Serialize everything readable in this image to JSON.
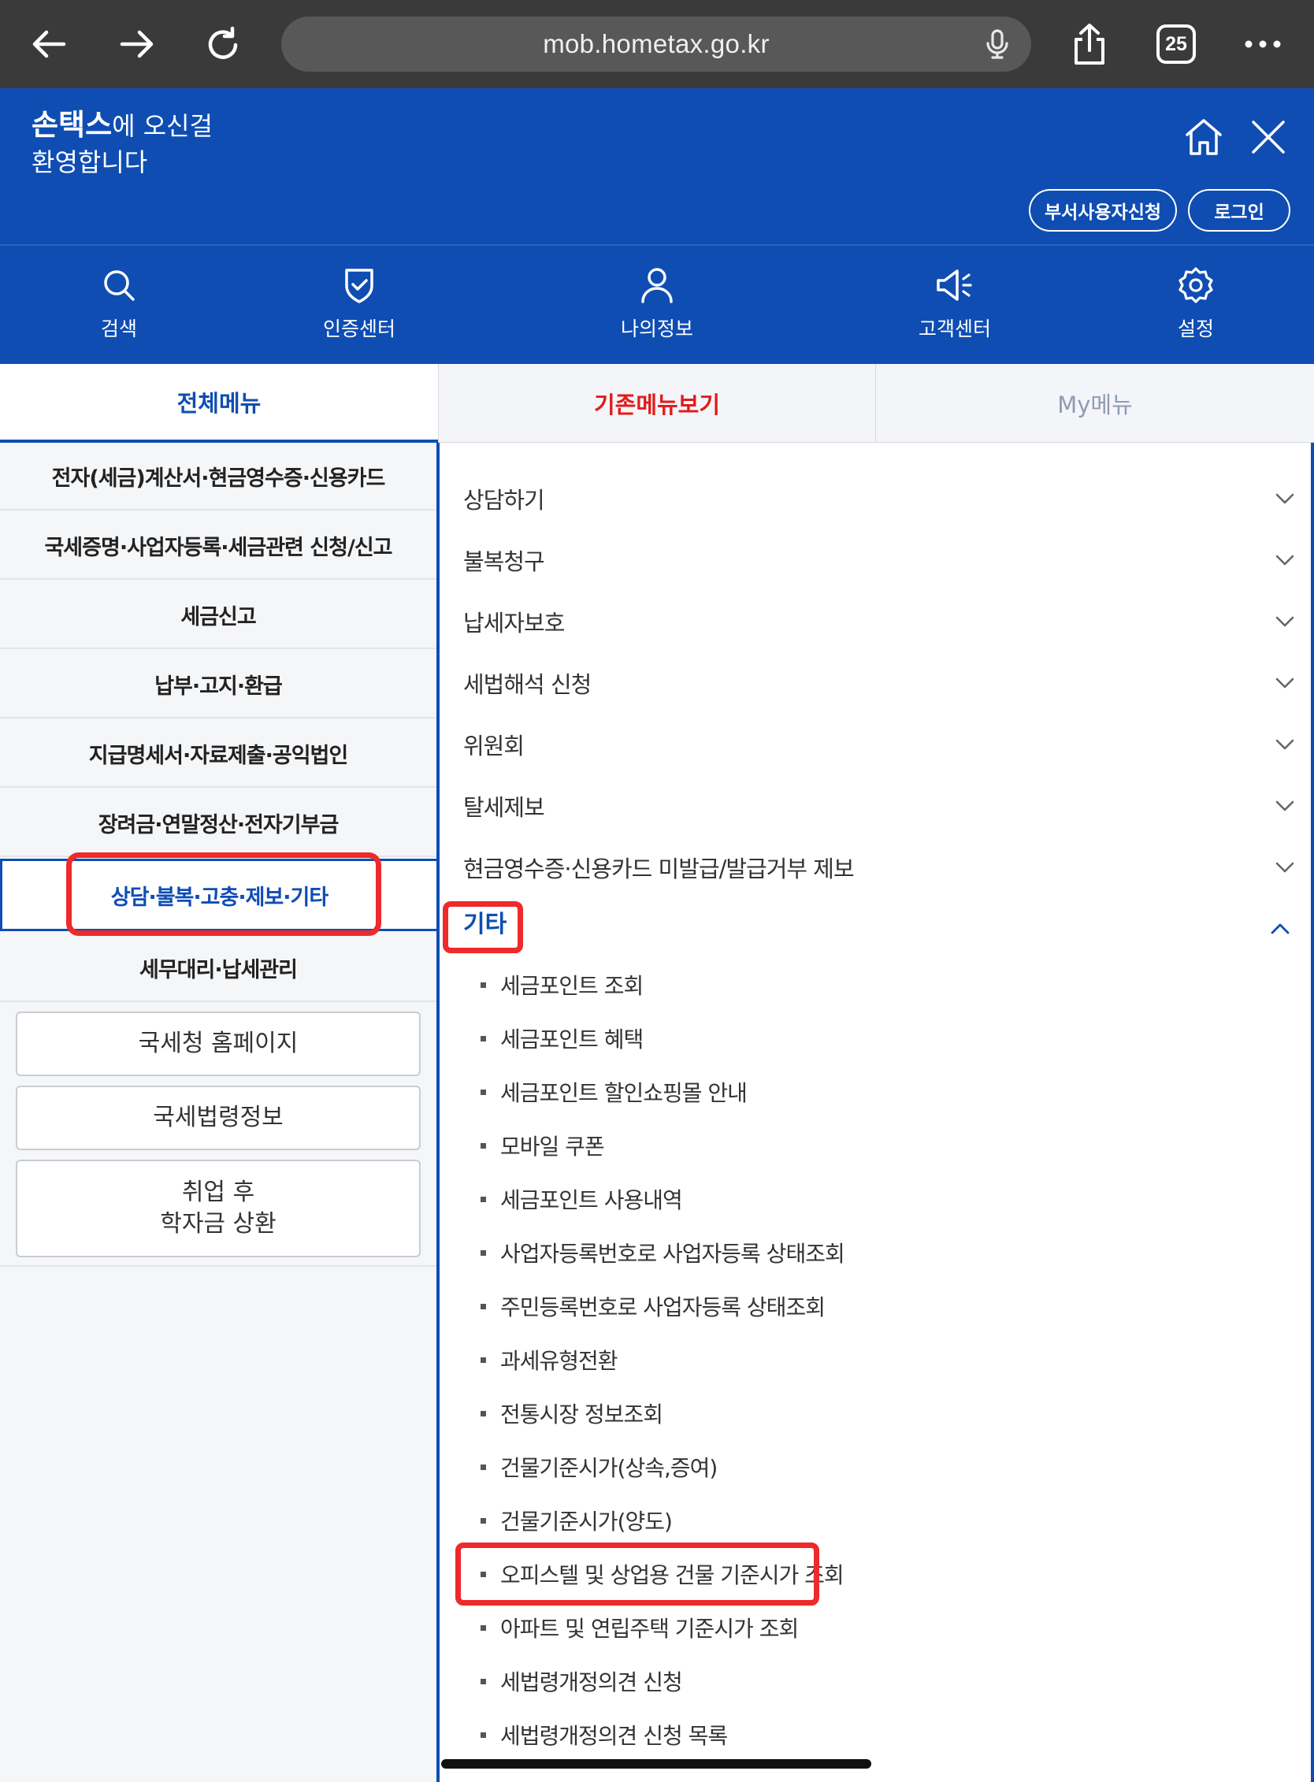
{
  "browser": {
    "url": "mob.hometax.go.kr",
    "tab_count": "25",
    "icons": [
      "back-arrow-icon",
      "forward-arrow-icon",
      "reload-icon",
      "microphone-icon",
      "share-icon",
      "tabs-icon",
      "more-icon"
    ]
  },
  "header": {
    "brand": "손택스",
    "welcome_suffix": "에 오신걸",
    "welcome_line2": "환영합니다",
    "dept_user_button": "부서사용자신청",
    "login_button": "로그인",
    "quick_menu": [
      {
        "label": "검색",
        "icon": "search-icon"
      },
      {
        "label": "인증센터",
        "icon": "shield-check-icon"
      },
      {
        "label": "나의정보",
        "icon": "person-icon"
      },
      {
        "label": "고객센터",
        "icon": "megaphone-icon"
      },
      {
        "label": "설정",
        "icon": "gear-icon"
      }
    ],
    "colors": {
      "primary": "#0f4db3"
    }
  },
  "tabs": {
    "all": "전체메뉴",
    "legacy": "기존메뉴보기",
    "my": "My메뉴"
  },
  "left_menu": {
    "items": [
      "전자(세금)계산서·현금영수증·신용카드",
      "국세증명·사업자등록·세금관련 신청/신고",
      "세금신고",
      "납부·고지·환급",
      "지급명세서·자료제출·공익법인",
      "장려금·연말정산·전자기부금",
      "상담·불복·고충·제보·기타",
      "세무대리·납세관리"
    ],
    "active_index": 6,
    "links": [
      "국세청 홈페이지",
      "국세법령정보"
    ],
    "loan_line1": "취업 후",
    "loan_line2": "학자금 상환"
  },
  "right_panel": {
    "accordion": [
      "상담하기",
      "불복청구",
      "납세자보호",
      "세법해석 신청",
      "위원회",
      "탈세제보",
      "현금영수증·신용카드 미발급/발급거부 제보"
    ],
    "expanded_label": "기타",
    "sub_items": [
      "세금포인트 조회",
      "세금포인트 혜택",
      "세금포인트 할인쇼핑몰 안내",
      "모바일 쿠폰",
      "세금포인트 사용내역",
      "사업자등록번호로 사업자등록 상태조회",
      "주민등록번호로 사업자등록 상태조회",
      "과세유형전환",
      "전통시장 정보조회",
      "건물기준시가(상속,증여)",
      "건물기준시가(양도)",
      "오피스텔 및 상업용 건물 기준시가 조회",
      "아파트 및 연립주택 기준시가 조회",
      "세법령개정의견 신청",
      "세법령개정의견 신청 목록"
    ]
  }
}
